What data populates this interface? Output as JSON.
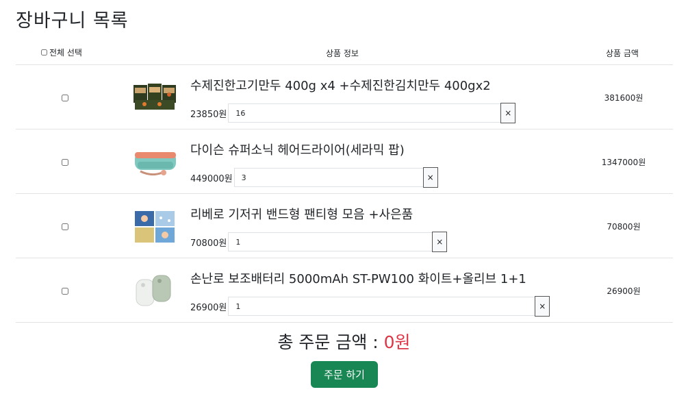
{
  "title": "장바구니 목록",
  "header": {
    "select_all": "전체 선택",
    "product_info": "상품 정보",
    "product_price": "상품 금액"
  },
  "items": [
    {
      "name": "수제진한고기만두 400g x4 +수제진한김치만두 400gx2",
      "unit_price": "23850원",
      "qty": "16",
      "total": "381600원",
      "remove": "×"
    },
    {
      "name": "다이슨 슈퍼소닉 헤어드라이어(세라믹 팝)",
      "unit_price": "449000원",
      "qty": "3",
      "total": "1347000원",
      "remove": "×"
    },
    {
      "name": "리베로 기저귀 밴드형 팬티형 모음 +사은품",
      "unit_price": "70800원",
      "qty": "1",
      "total": "70800원",
      "remove": "×"
    },
    {
      "name": "손난로 보조배터리 5000mAh ST-PW100 화이트+올리브 1+1",
      "unit_price": "26900원",
      "qty": "1",
      "total": "26900원",
      "remove": "×"
    }
  ],
  "summary": {
    "label": "총 주문 금액 :",
    "amount": "0원",
    "order_button": "주문 하기"
  },
  "colors": {
    "accent_green": "#198754",
    "amount_red": "#dc3545"
  }
}
